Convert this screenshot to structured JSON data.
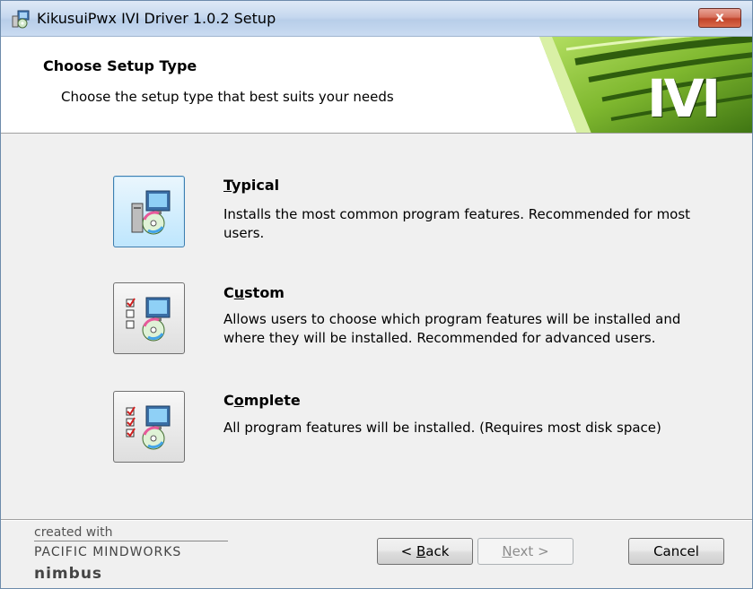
{
  "window": {
    "title": "KikusuiPwx IVI Driver 1.0.2 Setup",
    "close_label": "x"
  },
  "header": {
    "title": "Choose Setup Type",
    "subtitle": "Choose the setup type that best suits your needs",
    "banner_text": "IVI"
  },
  "options": [
    {
      "key": "T",
      "rest": "ypical",
      "description": "Installs the most common program features. Recommended for most users."
    },
    {
      "pre": "C",
      "key": "u",
      "rest": "stom",
      "description": "Allows users to choose which program features will be installed and where they will be installed. Recommended for advanced users."
    },
    {
      "pre": "C",
      "key": "o",
      "rest": "mplete",
      "description": "All program features will be installed.  (Requires most disk space)"
    }
  ],
  "branding": {
    "created": "created with",
    "company": "PACIFIC MINDWORKS",
    "product": "nimbus"
  },
  "buttons": {
    "back_pre": "< ",
    "back_key": "B",
    "back_rest": "ack",
    "next_key": "N",
    "next_rest": "ext >",
    "cancel": "Cancel"
  },
  "colors": {
    "banner_green": "#8cc63f",
    "banner_dark": "#2f5d0e",
    "active_button": "#bee6fd"
  }
}
